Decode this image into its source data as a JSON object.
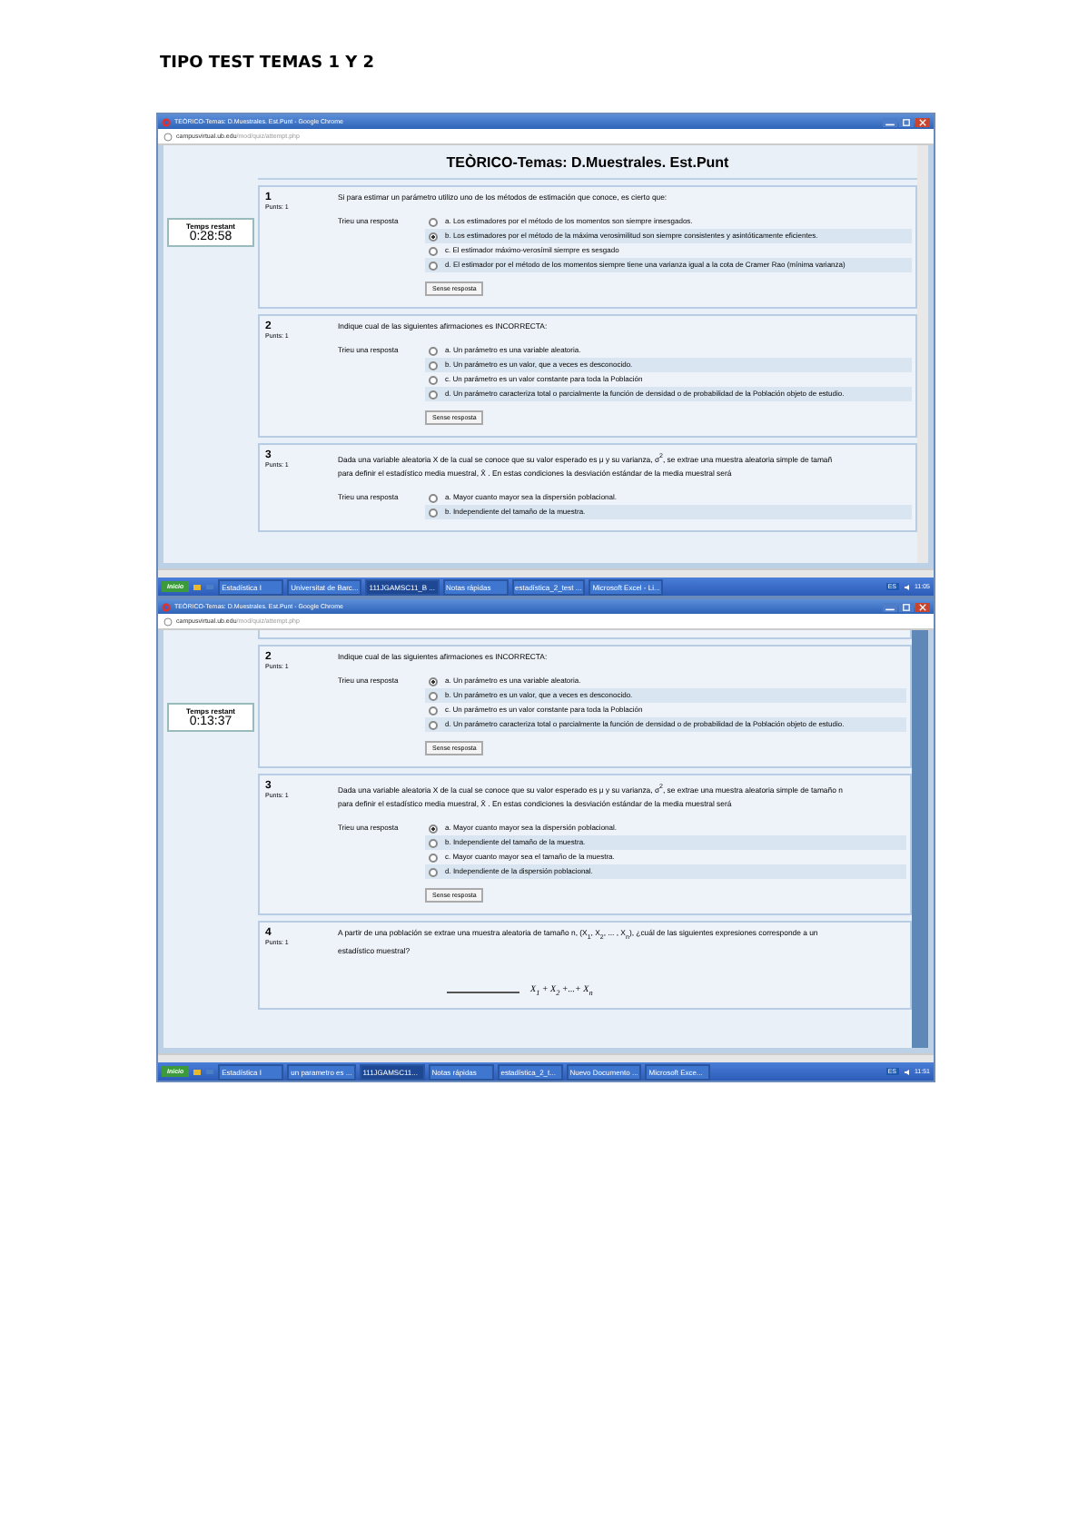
{
  "heading": "TIPO TEST TEMAS 1 Y 2",
  "screenshots": [
    {
      "window": {
        "title": "TEÒRICO-Temas: D.Muestrales. Est.Punt - Google Chrome"
      },
      "address": {
        "host": "campusvirtual.ub.edu",
        "path": "/mod/quiz/attempt.php"
      },
      "page_title": "TEÒRICO-Temas: D.Muestrales. Est.Punt",
      "timer": {
        "label": "Temps restant",
        "value": "0:28:58"
      },
      "questions": [
        {
          "number": "1",
          "points": "Punts: 1",
          "text": "Si para estimar un parámetro utilizo uno de los métodos de estimación que conoce, es cierto que:",
          "answer_label": "Trieu una resposta",
          "options": [
            {
              "text": "a. Los estimadores por el método de los momentos son siempre insesgados.",
              "selected": false
            },
            {
              "text": "b. Los estimadores por el método de la máxima verosimilitud son siempre consistentes y asintóticamente eficientes.",
              "selected": true
            },
            {
              "text": "c. El estimador máximo-verosímil siempre es sesgado",
              "selected": false
            },
            {
              "text": "d. El estimador por el método de los momentos siempre tiene una varianza igual a la cota de Cramer Rao (mínima varianza)",
              "selected": false
            }
          ],
          "button": "Sense resposta"
        },
        {
          "number": "2",
          "points": "Punts: 1",
          "text": "Indique cual de las siguientes afirmaciones es INCORRECTA:",
          "answer_label": "Trieu una resposta",
          "options": [
            {
              "text": "a. Un parámetro es una variable aleatoria.",
              "selected": false
            },
            {
              "text": "b. Un parámetro es un valor, que a veces es desconocido.",
              "selected": false
            },
            {
              "text": "c. Un parámetro es un valor constante para toda la Población",
              "selected": false
            },
            {
              "text": "d. Un parámetro caracteriza total o parcialmente la función de densidad o de probabilidad de la Población objeto de estudio.",
              "selected": false
            }
          ],
          "button": "Sense resposta"
        },
        {
          "number": "3",
          "points": "Punts: 1",
          "text": "Dada una variable aleatoria X de la cual se conoce que su valor esperado es μ y su varianza, σ$^{2}$, se extrae una muestra aleatoria simple de tamañ",
          "text_2": "para definir el estadístico media muestral, X̄ . En estas condiciones la desviación estándar de la media muestral será",
          "answer_label": "Trieu una resposta",
          "options": [
            {
              "text": "a. Mayor cuanto mayor sea la dispersión poblacional.",
              "selected": false
            },
            {
              "text": "b. Independiente del tamaño de la muestra.",
              "selected": false
            }
          ]
        }
      ],
      "taskbar": {
        "start": "Inicio",
        "items": [
          {
            "label": "Estadística I",
            "selected": false
          },
          {
            "label": "Universitat de Barc...",
            "selected": false
          },
          {
            "label": "111JGAMSC11_B ...",
            "selected": true
          },
          {
            "label": "Notas rápidas",
            "selected": false
          },
          {
            "label": "estadística_2_test ...",
            "selected": false
          },
          {
            "label": "Microsoft Excel - Li...",
            "selected": false
          }
        ],
        "language": "ES",
        "clock": "11:05"
      }
    },
    {
      "window": {
        "title": "TEÒRICO-Temas: D.Muestrales. Est.Punt - Google Chrome"
      },
      "address": {
        "host": "campusvirtual.ub.edu",
        "path": "/mod/quiz/attempt.php"
      },
      "timer": {
        "label": "Temps restant",
        "value": "0:13:37"
      },
      "questions": [
        {
          "number": "2",
          "points": "Punts: 1",
          "text": "Indique cual de las siguientes afirmaciones es INCORRECTA:",
          "answer_label": "Trieu una resposta",
          "options": [
            {
              "text": "a. Un parámetro es una variable aleatoria.",
              "selected": true
            },
            {
              "text": "b. Un parámetro es un valor, que a veces es desconocido.",
              "selected": false
            },
            {
              "text": "c. Un parámetro es un valor constante para toda la Población",
              "selected": false
            },
            {
              "text": "d. Un parámetro caracteriza total o parcialmente la función de densidad o de probabilidad de la Población objeto de estudio.",
              "selected": false
            }
          ],
          "button": "Sense resposta"
        },
        {
          "number": "3",
          "points": "Punts: 1",
          "text": "Dada una variable aleatoria X de la cual se conoce que su valor esperado es μ y su varianza, σ$^{2}$, se extrae una muestra aleatoria simple de tamaño n",
          "text_2": "para definir el estadístico media muestral, X̄ . En estas condiciones la desviación estándar de la media muestral será",
          "answer_label": "Trieu una resposta",
          "options": [
            {
              "text": "a. Mayor cuanto mayor sea la dispersión poblacional.",
              "selected": true
            },
            {
              "text": "b. Independiente del tamaño de la muestra.",
              "selected": false
            },
            {
              "text": "c. Mayor cuanto mayor sea el tamaño de la muestra.",
              "selected": false
            },
            {
              "text": "d. Independiente de la dispersión poblacional.",
              "selected": false
            }
          ],
          "button": "Sense resposta"
        },
        {
          "number": "4",
          "points": "Punts: 1",
          "text": "A partir de una población se extrae una muestra aleatoria de tamaño n, (X$_{1}$, X$_{2}$, ... , X$_{n}$), ¿cuál de las siguientes expresiones corresponde a un",
          "text_2": "estadístico muestral?",
          "formula": "X$_{1}$ + X$_{2}$ +...+ X$_{n}$"
        }
      ],
      "taskbar": {
        "start": "Inicio",
        "items": [
          {
            "label": "Estadística I",
            "selected": false
          },
          {
            "label": "un parametro es ...",
            "selected": false
          },
          {
            "label": "111JGAMSC11...",
            "selected": true
          },
          {
            "label": "Notas rápidas",
            "selected": false
          },
          {
            "label": "estadística_2_t...",
            "selected": false
          },
          {
            "label": "Nuevo Documento ...",
            "selected": false
          },
          {
            "label": "Microsoft Exce...",
            "selected": false
          }
        ],
        "language": "ES",
        "clock": "11:51"
      }
    }
  ]
}
